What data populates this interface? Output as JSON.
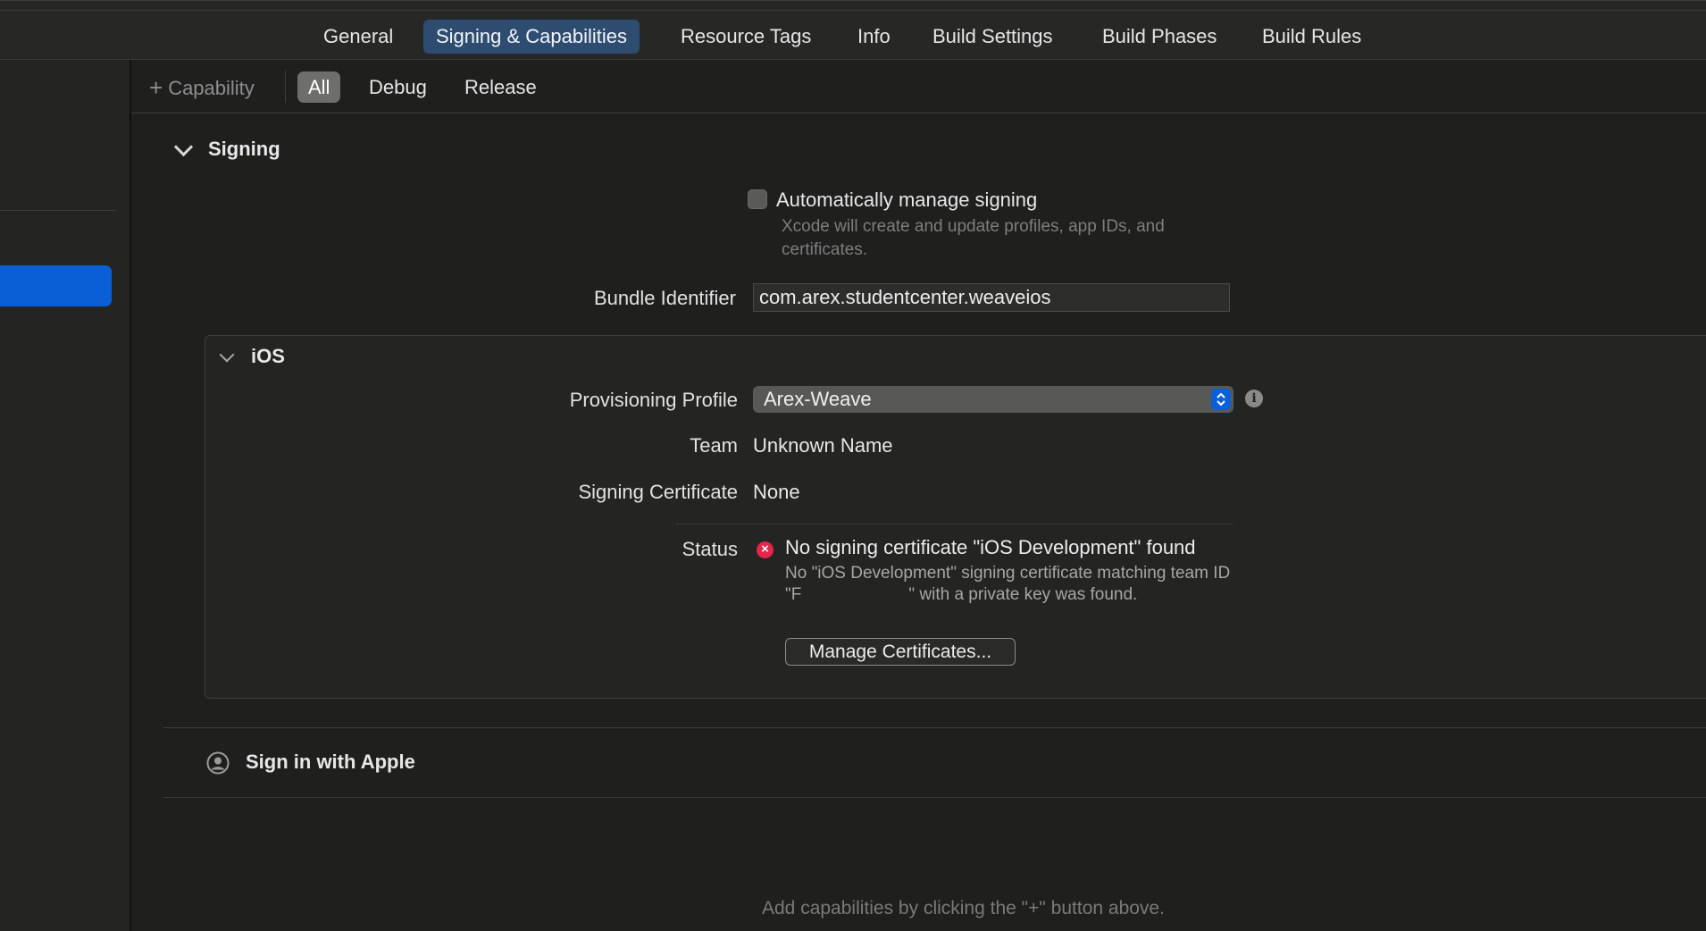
{
  "tabs": [
    {
      "label": "General"
    },
    {
      "label": "Signing & Capabilities",
      "active": true
    },
    {
      "label": "Resource Tags"
    },
    {
      "label": "Info"
    },
    {
      "label": "Build Settings"
    },
    {
      "label": "Build Phases"
    },
    {
      "label": "Build Rules"
    }
  ],
  "filter": {
    "capability_label": "Capability",
    "segments": [
      "All",
      "Debug",
      "Release"
    ],
    "selected": "All"
  },
  "signing": {
    "title": "Signing",
    "auto_manage_label": "Automatically manage signing",
    "auto_manage_checked": false,
    "auto_manage_hint": "Xcode will create and update profiles, app IDs, and certificates.",
    "bundle_label": "Bundle Identifier",
    "bundle_value": "com.arex.studentcenter.weaveios"
  },
  "ios": {
    "title": "iOS",
    "profile_label": "Provisioning Profile",
    "profile_value": "Arex-Weave",
    "team_label": "Team",
    "team_value": "Unknown Name",
    "cert_label": "Signing Certificate",
    "cert_value": "None",
    "status_label": "Status",
    "status_title": "No signing certificate \"iOS Development\" found",
    "status_desc_1": "No \"iOS Development\" signing certificate matching team ID \"F",
    "status_desc_2": "\" with a private key was found.",
    "manage_button": "Manage Certificates..."
  },
  "sign_in_apple": {
    "title": "Sign in with Apple"
  },
  "footer_hint": "Add capabilities by clicking the \"+\" button above.",
  "colors": {
    "accent": "#0a5fd6",
    "active_tab": "#2d4c6f",
    "error": "#e3264a"
  }
}
